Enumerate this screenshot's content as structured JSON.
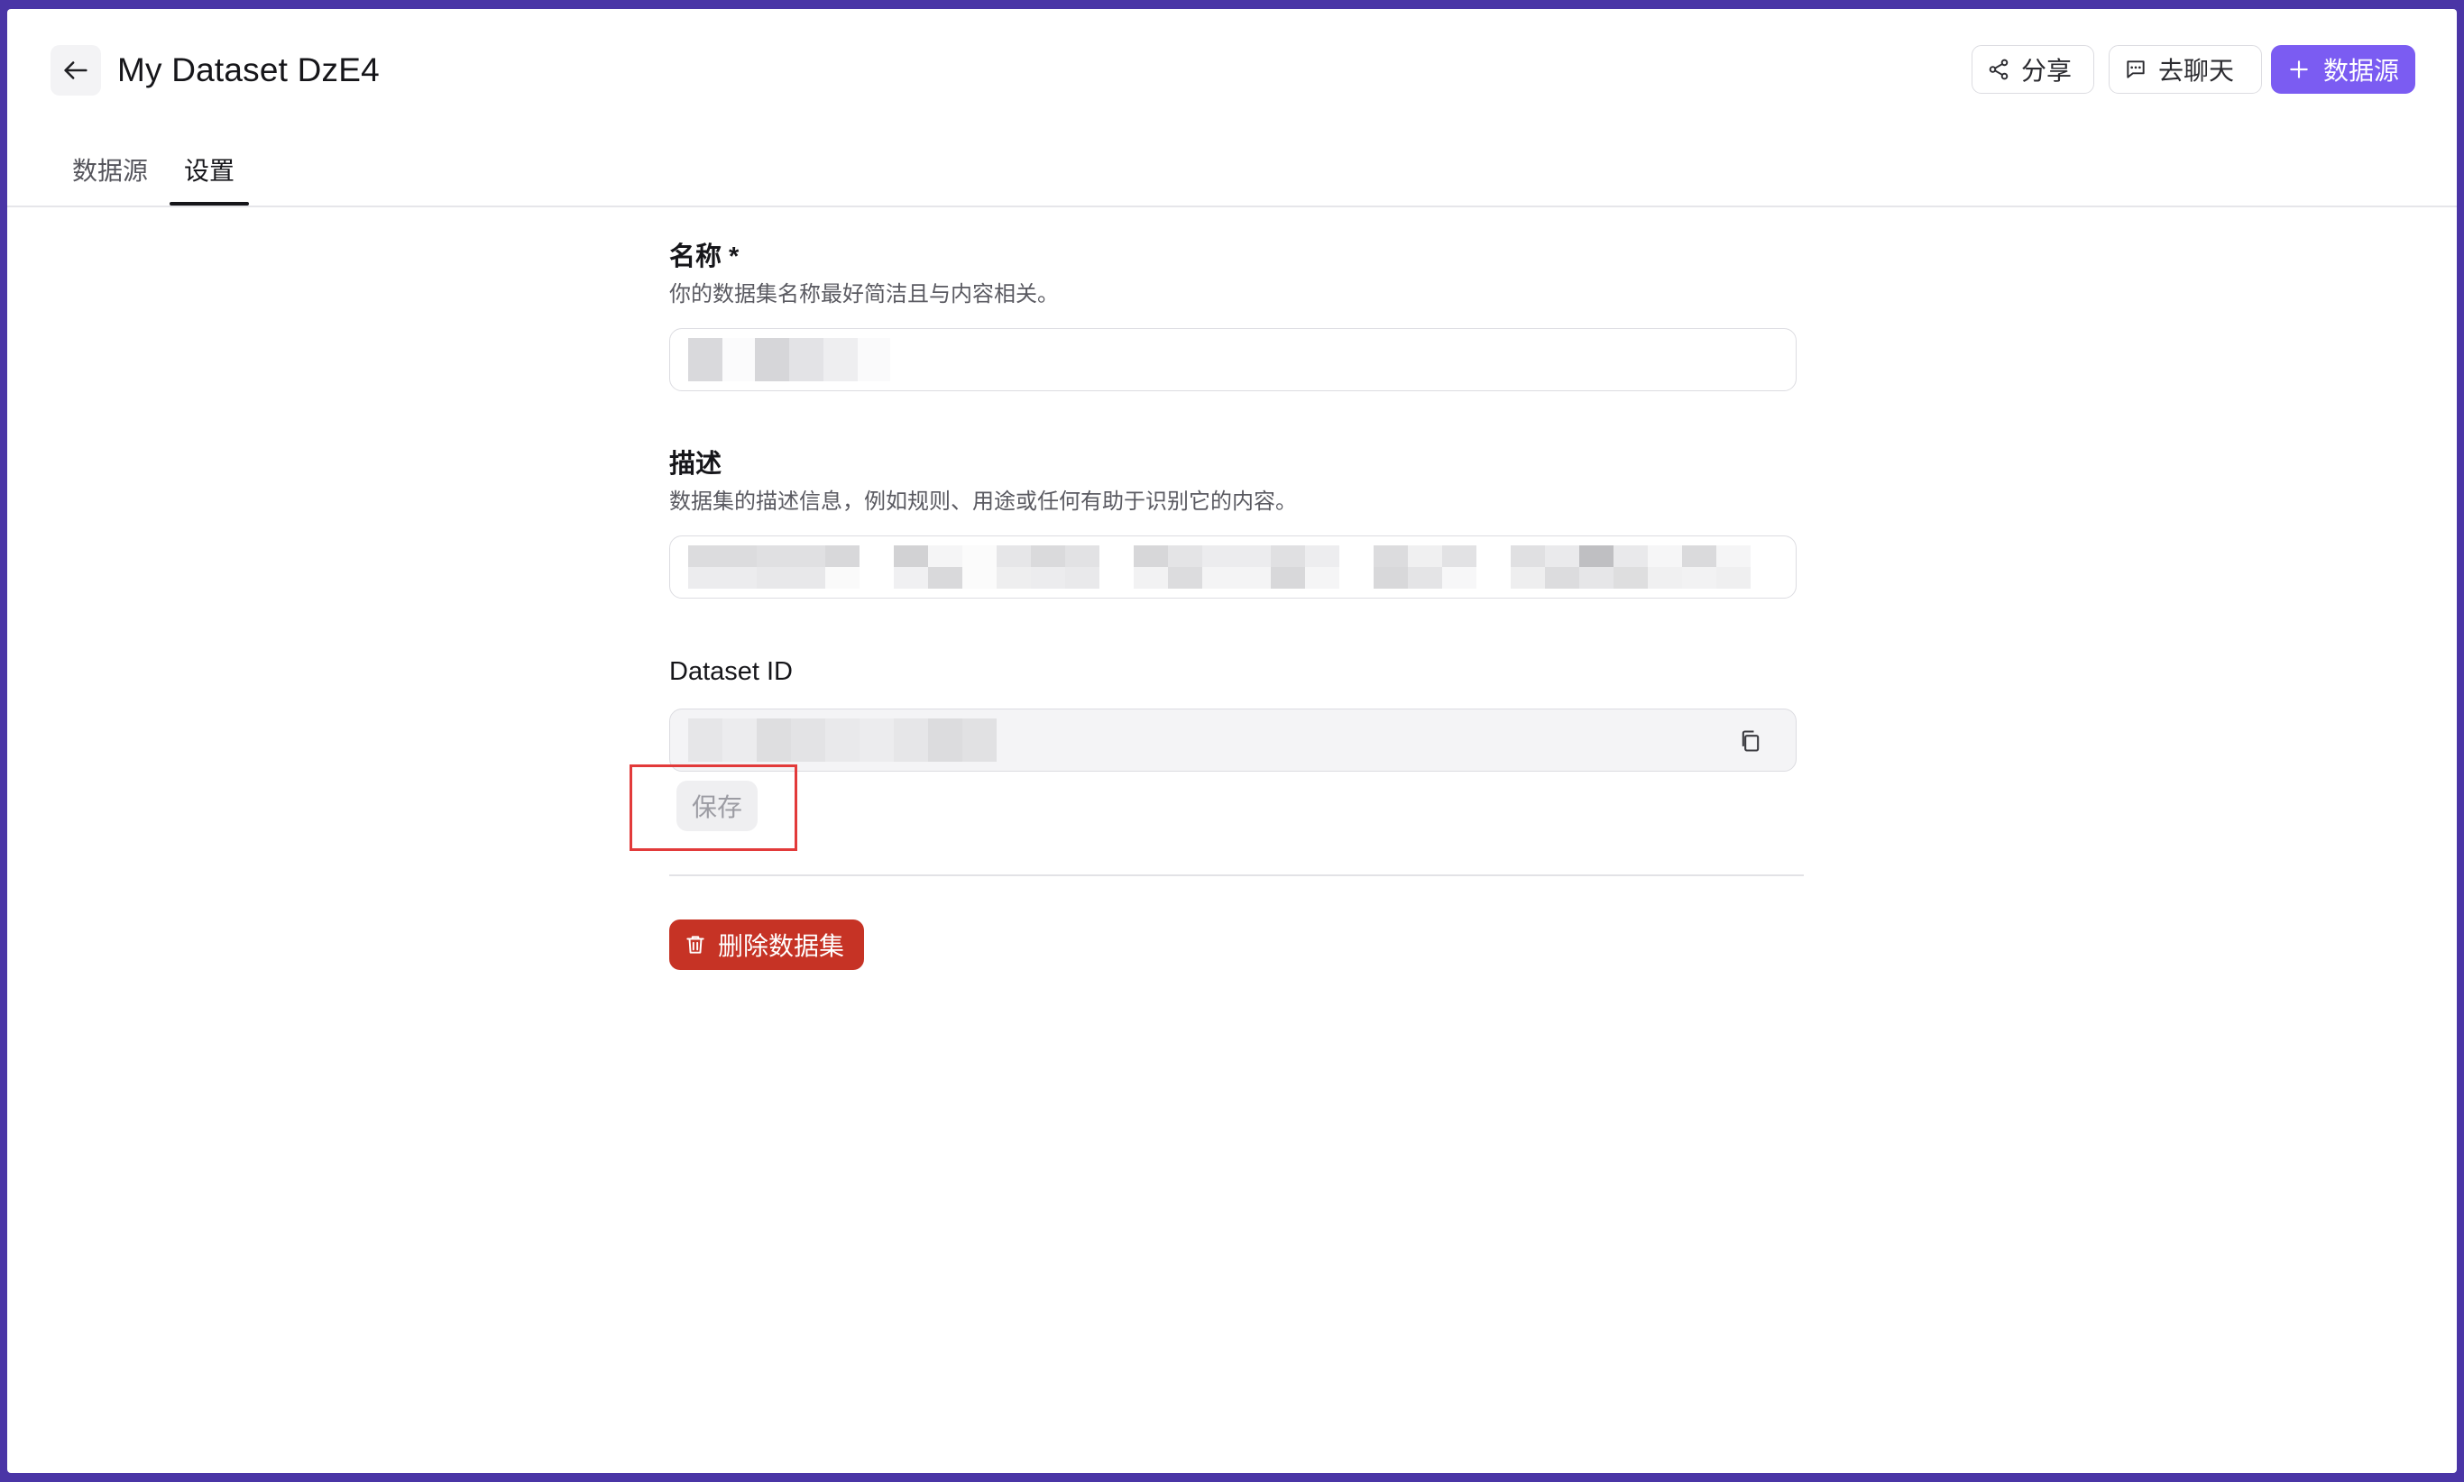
{
  "header": {
    "title": "My Dataset DzE4",
    "share_label": "分享",
    "chat_label": "去聊天",
    "add_label": "数据源",
    "accent": "#7b5cf2"
  },
  "tabs": [
    {
      "label": "数据源",
      "active": false
    },
    {
      "label": "设置",
      "active": true
    }
  ],
  "form": {
    "name": {
      "label": "名称 *",
      "hint": "你的数据集名称最好简洁且与内容相关。",
      "value_obscured": true
    },
    "description": {
      "label": "描述",
      "hint": "数据集的描述信息，例如规则、用途或任何有助于识别它的内容。",
      "value_obscured": true
    },
    "dataset_id": {
      "label": "Dataset ID",
      "value_obscured": true,
      "icon": "copy-icon"
    },
    "save_label": "保存",
    "delete_label": "删除数据集",
    "delete_color": "#c63325"
  }
}
